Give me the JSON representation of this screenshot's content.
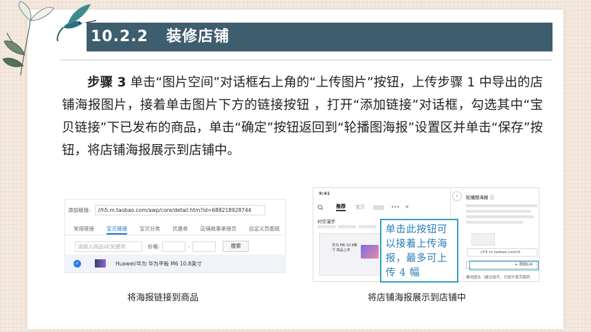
{
  "header": {
    "number": "10.2.2",
    "title": "装修店铺"
  },
  "paragraph": {
    "step_label": "步骤 3",
    "text": " 单击“图片空间”对话框右上角的“上传图片”按钮，上传步骤 1 中导出的店铺海报图片，接着单击图片下方的链接按钮 ，打开“添加链接”对话框，勾选其中“宝贝链接”下已发布的商品，单击“确定”按钮返回到“轮播图海报”设置区并单击“保存”按钮，将店铺海报展示到店铺中。"
  },
  "left_screenshot": {
    "link_label": "添加链接:",
    "link_url": "//h5.m.taobao.com/awp/core/detail.htm?id=688218928744",
    "tabs": [
      "常用链接",
      "宝贝链接",
      "宝贝分类",
      "优惠券",
      "店铺故事承接页",
      "自定义页面链"
    ],
    "active_tab_index": 1,
    "search_placeholder": "请输入商品id/关键词",
    "price_label": "价格:",
    "price_separator": "-",
    "search_button": "搜索",
    "item_name": "Huawei/华为 华为平板 M6 10.8英寸",
    "check_mark": "✓"
  },
  "right_screenshot": {
    "time": "9:41",
    "nav_recommend": "推荐",
    "nav_baby": "宝贝",
    "nav_more": "•••",
    "nav_close": "✕",
    "shop_name": "衬空漫步",
    "banner_text": "华为 M6 10.8英寸 高品上市",
    "panel_title": "轮播图海报 ⓘ",
    "url_value": "//h5.m.taobao.com/⊘",
    "add_button": "+ 添加1/4",
    "bottom_text": "模块图名（建议填写，可提升首页跳转",
    "back_icon": "‹"
  },
  "callout": {
    "text": "单击此按钮可以接着上传海报，最多可上传 4 幅"
  },
  "captions": {
    "left": "将海报链接到商品",
    "right": "将店铺海报展示到店铺中"
  },
  "colors": {
    "title_bar": "#3e5d6e",
    "callout_border": "#2f9fbf",
    "callout_text": "#2a7fb5",
    "active_tab": "#1f6fd8"
  }
}
